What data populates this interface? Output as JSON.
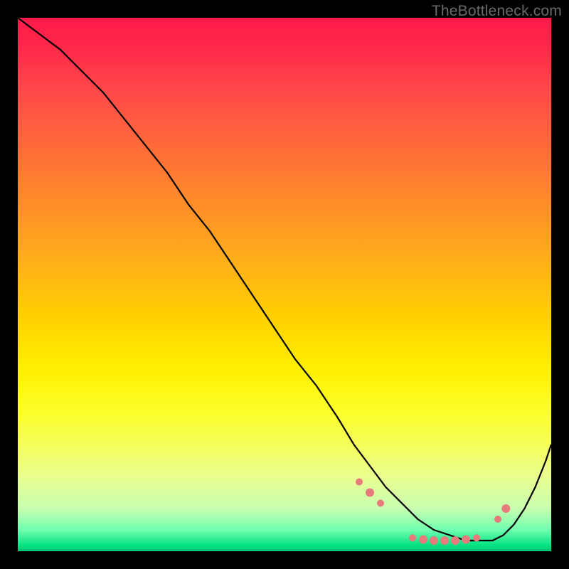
{
  "watermark": "TheBottleneck.com",
  "chart_data": {
    "type": "line",
    "title": "",
    "xlabel": "",
    "ylabel": "",
    "xlim": [
      0,
      100
    ],
    "ylim": [
      0,
      100
    ],
    "background_gradient": {
      "direction": "vertical",
      "stops": [
        {
          "pos": 0.0,
          "color": "#ff1a4a"
        },
        {
          "pos": 0.14,
          "color": "#ff4a4a"
        },
        {
          "pos": 0.34,
          "color": "#ff8a2a"
        },
        {
          "pos": 0.56,
          "color": "#ffd000"
        },
        {
          "pos": 0.74,
          "color": "#fcff2a"
        },
        {
          "pos": 0.92,
          "color": "#c8ffb0"
        },
        {
          "pos": 0.99,
          "color": "#00e080"
        }
      ]
    },
    "series": [
      {
        "name": "bottleneck-curve",
        "x": [
          0,
          4,
          8,
          12,
          16,
          20,
          24,
          28,
          32,
          36,
          40,
          44,
          48,
          52,
          56,
          60,
          63,
          66,
          69,
          72,
          75,
          78,
          81,
          84,
          87,
          89,
          91,
          93,
          95,
          97,
          99,
          100
        ],
        "y": [
          100,
          97,
          94,
          90,
          86,
          81,
          76,
          71,
          65,
          60,
          54,
          48,
          42,
          36,
          31,
          25,
          20,
          16,
          12,
          9,
          6,
          4,
          3,
          2,
          2,
          2,
          3,
          5,
          8,
          12,
          17,
          20
        ]
      }
    ],
    "markers": {
      "name": "highlight-points",
      "color": "#e77a7a",
      "points": [
        {
          "x": 64,
          "y": 13,
          "r": 5
        },
        {
          "x": 66,
          "y": 11,
          "r": 6
        },
        {
          "x": 68,
          "y": 9,
          "r": 5
        },
        {
          "x": 74,
          "y": 2.5,
          "r": 5
        },
        {
          "x": 76,
          "y": 2.2,
          "r": 6
        },
        {
          "x": 78,
          "y": 2.0,
          "r": 6
        },
        {
          "x": 80,
          "y": 2.0,
          "r": 6
        },
        {
          "x": 82,
          "y": 2.0,
          "r": 6
        },
        {
          "x": 84,
          "y": 2.2,
          "r": 6
        },
        {
          "x": 86,
          "y": 2.5,
          "r": 5
        },
        {
          "x": 90,
          "y": 6,
          "r": 5
        },
        {
          "x": 91.5,
          "y": 8,
          "r": 6
        }
      ]
    }
  }
}
